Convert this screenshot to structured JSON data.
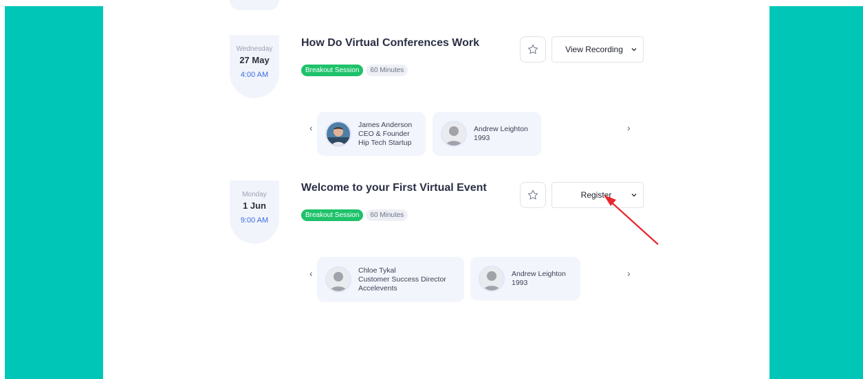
{
  "sessions": [
    {
      "weekday": "Wednesday",
      "date": "27 May",
      "time": "4:00 AM",
      "title": "How Do Virtual Conferences Work",
      "tag": "Breakout Session",
      "duration": "60 Minutes",
      "action_label": "View Recording",
      "speakers": [
        {
          "name": "James Anderson",
          "role": "CEO & Founder",
          "company": "Hip Tech Startup",
          "avatar": "photo-avatar"
        },
        {
          "name": "Andrew Leighton",
          "role": "1993",
          "company": "",
          "avatar": "placeholder-avatar"
        }
      ]
    },
    {
      "weekday": "Monday",
      "date": "1 Jun",
      "time": "9:00 AM",
      "title": "Welcome to your First Virtual Event",
      "tag": "Breakout Session",
      "duration": "60 Minutes",
      "action_label": "Register",
      "speakers": [
        {
          "name": "Chloe Tykal",
          "role": "Customer Success Director",
          "company": "Accelevents",
          "avatar": "placeholder-avatar"
        },
        {
          "name": "Andrew Leighton",
          "role": "1993",
          "company": "",
          "avatar": "placeholder-avatar"
        }
      ]
    }
  ],
  "nav": {
    "prev": "‹",
    "next": "›"
  },
  "colors": {
    "side_panel": "#00c6b8",
    "tag_green": "#1ec26a",
    "time_blue": "#3b6de0",
    "annotation_arrow": "#e8262b"
  },
  "icons": {
    "favorite": "star-outline-icon",
    "dropdown": "chevron-down-icon",
    "annotation": "red-arrow-icon"
  }
}
